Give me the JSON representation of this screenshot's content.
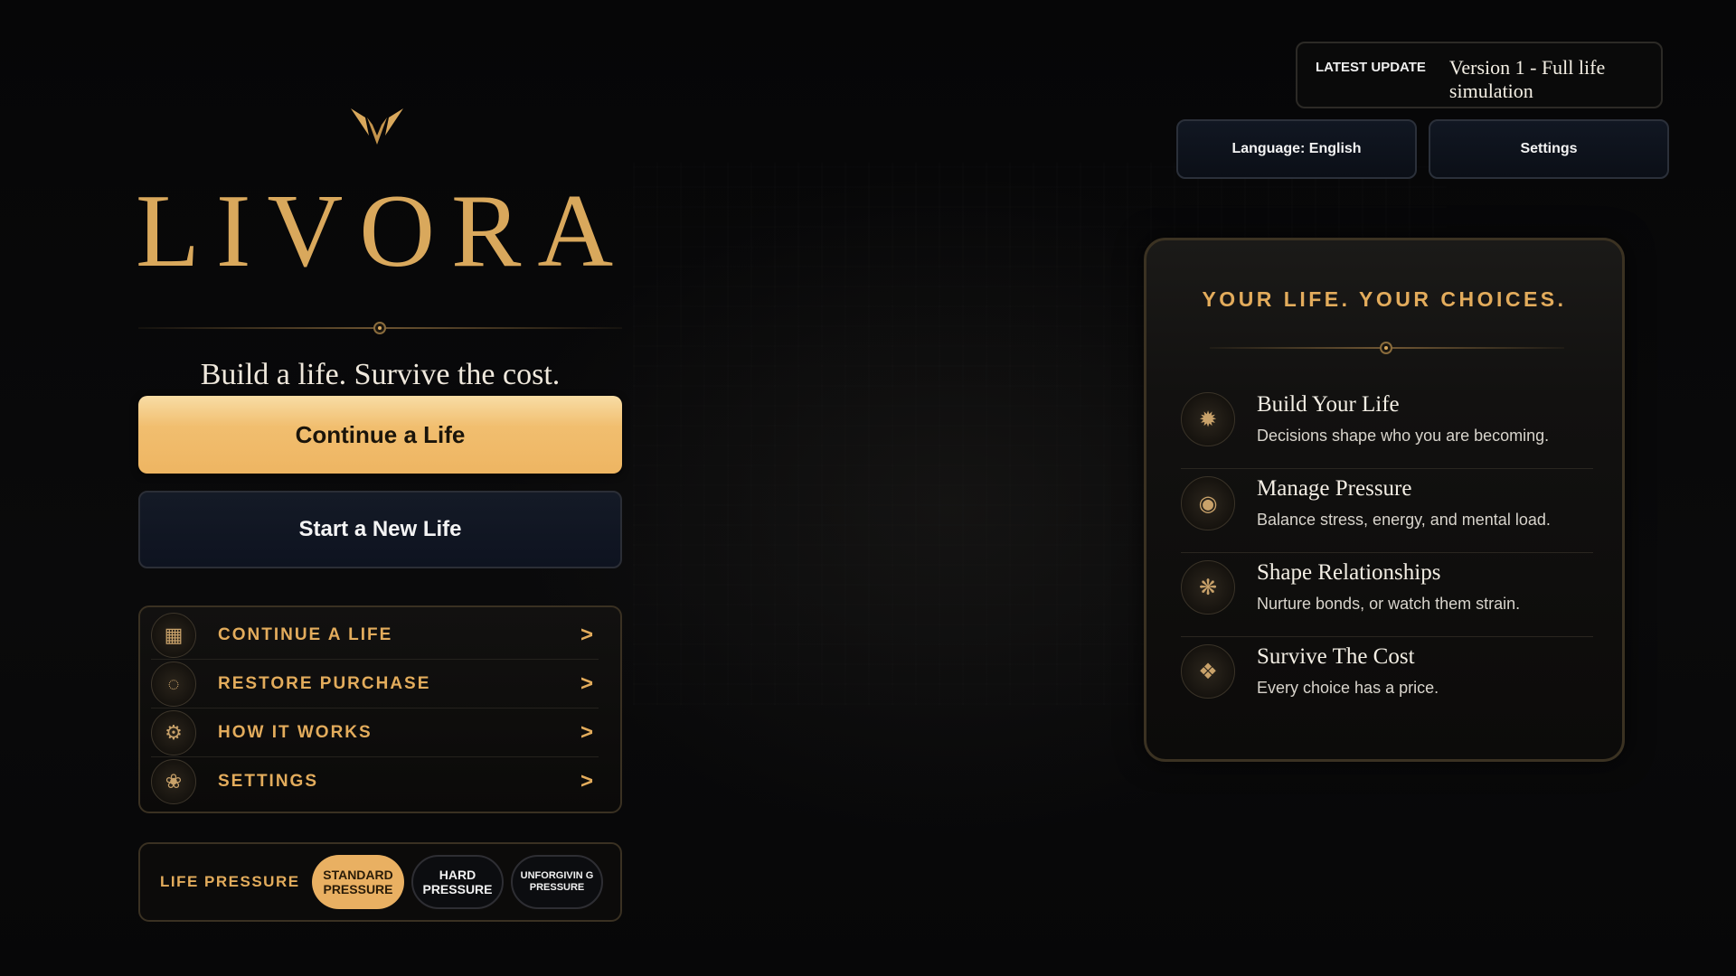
{
  "brand": {
    "name": "LIVORA",
    "tagline": "Build a life. Survive the cost."
  },
  "actions": {
    "continue_label": "Continue a Life",
    "new_life_label": "Start a New Life"
  },
  "menu": {
    "items": [
      {
        "label": "CONTINUE A LIFE",
        "arrow": ">",
        "icon": "map-icon"
      },
      {
        "label": "RESTORE PURCHASE",
        "arrow": ">",
        "icon": "bulb-icon"
      },
      {
        "label": "HOW IT WORKS",
        "arrow": ">",
        "icon": "gear-icon"
      },
      {
        "label": "SETTINGS",
        "arrow": ">",
        "icon": "brain-icon"
      }
    ]
  },
  "pressure": {
    "label": "LIFE PRESSURE",
    "options": [
      "STANDARD PRESSURE",
      "HARD PRESSURE",
      "UNFORGIVIN G PRESSURE"
    ],
    "selected": "STANDARD PRESSURE"
  },
  "update": {
    "label": "LATEST UPDATE",
    "text": "Version 1 - Full life simulation"
  },
  "top_buttons": {
    "language": "Language: English",
    "settings": "Settings"
  },
  "features": {
    "title": "YOUR LIFE. YOUR CHOICES.",
    "items": [
      {
        "name": "Build Your Life",
        "desc": "Decisions shape who you are becoming.",
        "icon": "compass-icon"
      },
      {
        "name": "Manage Pressure",
        "desc": "Balance stress, energy, and mental load.",
        "icon": "gauge-icon"
      },
      {
        "name": "Shape Relationships",
        "desc": "Nurture bonds, or watch them strain.",
        "icon": "network-icon"
      },
      {
        "name": "Survive The Cost",
        "desc": "Every choice has a price.",
        "icon": "shield-icon"
      }
    ]
  },
  "colors": {
    "accent_gold": "#e3ac5c",
    "brand_gold": "#d9a85c",
    "primary_button": "#f1be6f",
    "navy_button": "#0e1320",
    "background": "#050506"
  }
}
